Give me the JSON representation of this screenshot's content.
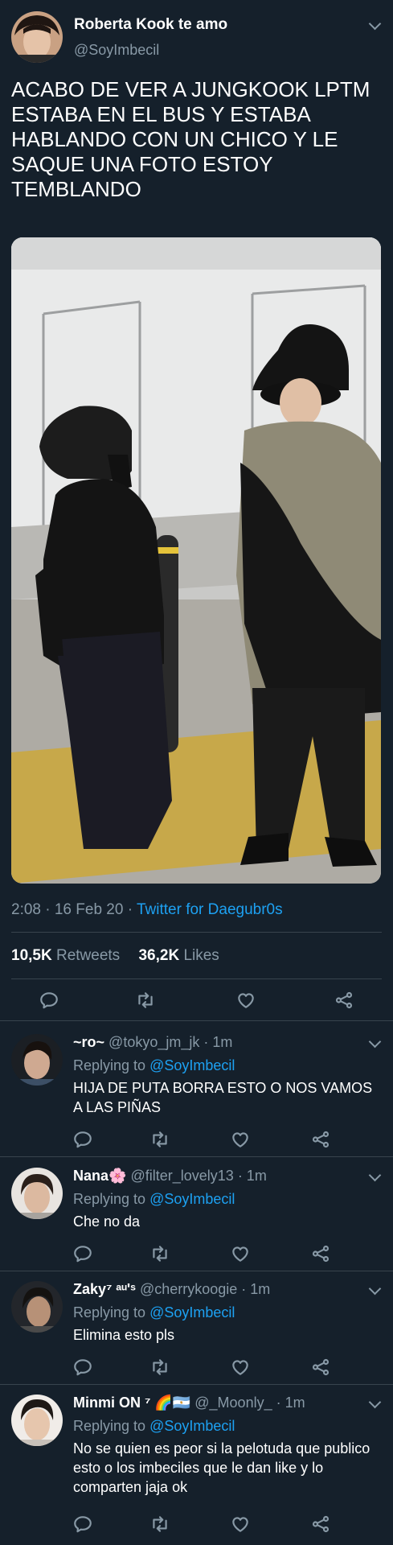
{
  "main_tweet": {
    "display_name": "Roberta Kook te amo",
    "handle": "@SoyImbecil",
    "text": "ACABO DE VER A JUNGKOOK LPTM ESTABA EN EL BUS Y ESTABA HABLANDO CON UN CHICO Y LE SAQUE UNA FOTO ESTOY TEMBLANDO",
    "timestamp": "2:08 · 16 Feb 20 · ",
    "source": "Twitter for Daegubr0s",
    "retweets_count": "10,5K",
    "retweets_label": "Retweets",
    "likes_count": "36,2K",
    "likes_label": "Likes"
  },
  "replies": [
    {
      "display_name": "~ro~",
      "handle": "@tokyo_jm_jk",
      "time": "· 1m",
      "replying_prefix": "Replying to ",
      "replying_to": "@SoyImbecil",
      "text": "HIJA DE PUTA BORRA ESTO O NOS VAMOS A LAS PIÑAS"
    },
    {
      "display_name": "Nana🌸",
      "handle": "@filter_lovely13",
      "time": "· 1m",
      "replying_prefix": "Replying to ",
      "replying_to": "@SoyImbecil",
      "text": "Che no da"
    },
    {
      "display_name": "Zaky⁷ ᵃᵘ'ˢ",
      "handle": "@cherrykoogie",
      "time": "· 1m",
      "replying_prefix": "Replying to ",
      "replying_to": "@SoyImbecil",
      "text": "Elimina esto pls"
    },
    {
      "display_name": "Minmi ON ⁷ 🌈🇦🇷",
      "handle": "@_Moonly_",
      "time": "· 1m",
      "replying_prefix": "Replying to ",
      "replying_to": "@SoyImbecil",
      "text": "No se quien es peor si la pelotuda que publico esto o los imbeciles que le dan like y lo comparten jaja ok"
    }
  ],
  "colors": {
    "background": "#15202b",
    "text_primary": "#ffffff",
    "text_muted": "#8899a6",
    "link": "#1da1f2",
    "divider": "#38444d"
  },
  "icons": [
    "chevron-down-icon",
    "reply-icon",
    "retweet-icon",
    "like-icon",
    "share-icon"
  ]
}
